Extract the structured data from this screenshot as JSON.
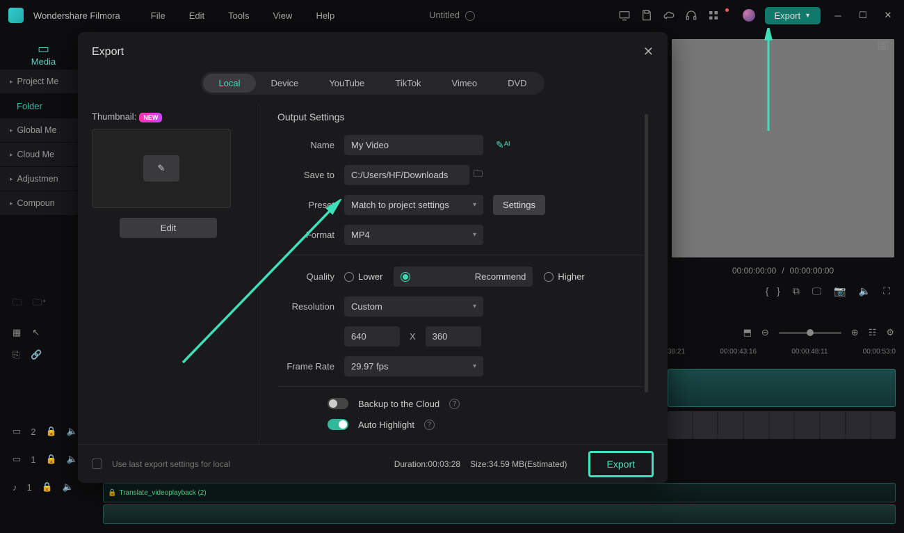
{
  "app_name": "Wondershare Filmora",
  "menu": {
    "file": "File",
    "edit": "Edit",
    "tools": "Tools",
    "view": "View",
    "help": "Help"
  },
  "project_title": "Untitled",
  "titlebar_export": "Export",
  "side": {
    "media_tab": "Media",
    "project": "Project Me",
    "folder": "Folder",
    "global": "Global Me",
    "cloud": "Cloud Me",
    "adjustment": "Adjustmen",
    "compound": "Compoun"
  },
  "preview": {
    "cur": "00:00:00:00",
    "sep": "/",
    "total": "00:00:00:00"
  },
  "ruler": {
    "t1": "38:21",
    "t2": "00:00:43:16",
    "t3": "00:00:48:11",
    "t4": "00:00:53:0"
  },
  "tracks": {
    "v": "2",
    "v2": "1",
    "a": "1"
  },
  "modal": {
    "title": "Export",
    "tabs": {
      "local": "Local",
      "device": "Device",
      "youtube": "YouTube",
      "tiktok": "TikTok",
      "vimeo": "Vimeo",
      "dvd": "DVD"
    },
    "thumb_label": "Thumbnail:",
    "new": "NEW",
    "edit": "Edit",
    "section": "Output Settings",
    "labels": {
      "name": "Name",
      "saveto": "Save to",
      "preset": "Preset",
      "format": "Format",
      "quality": "Quality",
      "resolution": "Resolution",
      "framerate": "Frame Rate"
    },
    "values": {
      "name": "My Video",
      "saveto": "C:/Users/HF/Downloads",
      "preset": "Match to project settings",
      "format": "MP4",
      "resolution": "Custom",
      "width": "640",
      "height": "360",
      "framerate": "29.97 fps"
    },
    "x_label": "X",
    "settings_btn": "Settings",
    "quality": {
      "lower": "Lower",
      "recommend": "Recommend",
      "higher": "Higher"
    },
    "backup": "Backup to the Cloud",
    "auto_highlight": "Auto Highlight",
    "use_last": "Use last export settings for local",
    "duration_label": "Duration:",
    "duration": "00:03:28",
    "size_label": "Size:",
    "size": "34.59 MB",
    "estimated": "(Estimated)",
    "export_btn": "Export"
  },
  "audio_track": "Translate_videoplayback (2)"
}
